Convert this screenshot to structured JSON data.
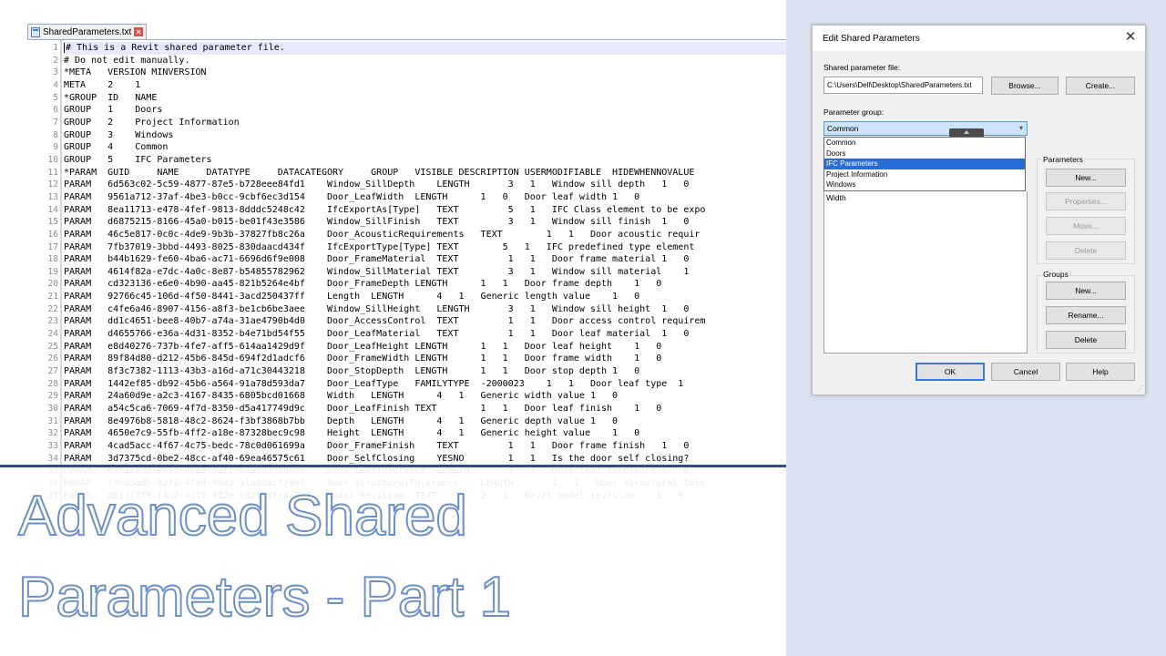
{
  "editor": {
    "tab_label": "SharedParameters.txt",
    "lines": [
      "# This is a Revit shared parameter file.",
      "# Do not edit manually.",
      "*META   VERSION MINVERSION",
      "META    2    1",
      "*GROUP  ID   NAME",
      "GROUP   1    Doors",
      "GROUP   2    Project Information",
      "GROUP   3    Windows",
      "GROUP   4    Common",
      "GROUP   5    IFC Parameters",
      "*PARAM  GUID     NAME     DATATYPE     DATACATEGORY     GROUP   VISIBLE DESCRIPTION USERMODIFIABLE  HIDEWHENNOVALUE",
      "PARAM   6d563c02-5c59-4877-87e5-b728eee84fd1    Window_SillDepth    LENGTH       3   1   Window sill depth   1   0",
      "PARAM   9561a712-37af-4be3-b0cc-9cbf6ec3d154    Door_LeafWidth  LENGTH      1   0   Door leaf width 1   0",
      "PARAM   8ea11713-e478-4fef-9813-8dddc5248c42    IfcExportAs[Type]   TEXT         5   1   IFC Class element to be expo",
      "PARAM   d6875215-8166-45a0-b015-be01f43e3586    Window_SillFinish   TEXT         3   1   Window sill finish  1   0",
      "PARAM   46c5e817-0c0c-4de9-9b3b-37827fb8c26a    Door_AcousticRequirements   TEXT        1   1   Door acoustic requir",
      "PARAM   7fb37019-3bbd-4493-8025-830daacd434f    IfcExportType[Type] TEXT        5   1   IFC predefined type element",
      "PARAM   b44b1629-fe60-4ba6-ac71-6696d6f9e008    Door_FrameMaterial  TEXT         1   1   Door frame material 1   0",
      "PARAM   4614f82a-e7dc-4a0c-8e87-b54855782962    Window_SillMaterial TEXT         3   1   Window sill material    1",
      "PARAM   cd323136-e6e0-4b90-aa45-821b5264e4bf    Door_FrameDepth LENGTH      1   1   Door frame depth    1   0",
      "PARAM   92766c45-106d-4f50-8441-3acd250437ff    Length  LENGTH      4   1   Generic length value    1   0",
      "PARAM   c4fe6a46-8907-4156-a8f3-be1cb6be3aee    Window_SillHeight   LENGTH       3   1   Window sill height  1   0",
      "PARAM   dd1c4651-bee8-40b7-a74a-31ae4790b4d0    Door_AccessControl  TEXT         1   1   Door access control requirem",
      "PARAM   d4655766-e36a-4d31-8352-b4e71bd54f55    Door_LeafMaterial   TEXT         1   1   Door leaf material  1   0",
      "PARAM   e8d40276-737b-4fe7-aff5-614aa1429d9f    Door_LeafHeight LENGTH      1   1   Door leaf height    1   0",
      "PARAM   89f84d80-d212-45b6-845d-694f2d1adcf6    Door_FrameWidth LENGTH      1   1   Door frame width    1   0",
      "PARAM   8f3c7382-1113-43b3-a16d-a71c30443218    Door_StopDepth  LENGTH      1   1   Door stop depth 1   0",
      "PARAM   1442ef85-db92-45b6-a564-91a78d593da7    Door_LeafType   FAMILYTYPE  -2000023    1   1   Door leaf type  1",
      "PARAM   24a60d9e-a2c3-4167-8435-6805bcd01668    Width   LENGTH      4   1   Generic width value 1   0",
      "PARAM   a54c5ca6-7069-4f7d-8350-d5a417749d9c    Door_LeafFinish TEXT        1   1   Door leaf finish    1   0",
      "PARAM   8e4976b8-5818-48c2-8624-f3bf3868b7bb    Depth   LENGTH      4   1   Generic depth value 1   0",
      "PARAM   4650e7c9-55fb-4ff2-a18e-87328bec9c98    Height  LENGTH      4   1   Generic height value    1   0",
      "PARAM   4cad5acc-4f67-4c75-bedc-78c0d061699a    Door_FrameFinish    TEXT         1   1   Door frame finish   1   0",
      "PARAM   3d7375cd-0be2-48cc-af40-69ea46575c61    Door_SelfClosing    YESNO        1   1   Is the door self closing?",
      "PARAM   63b14ad0-904c-46e5-a1f7-679553aeb666    Door_LeafTolerance  LENGTH       1   1   Door leaf tolerance 1   0",
      "PARAM   f30a5adb-82f1-4fa4-80d2-a1a8dacf7906    Door_StructuralTolerance    LENGTH       1   1   Door structural tole",
      "PARAM   d61d17f0-14c2-4c17-932e-c02fb4fe8a70    Model Revision  TEXT        2   1   Revit model revision    1   0"
    ]
  },
  "slide": {
    "title_line1": "Advanced Shared",
    "title_line2": "Parameters - Part 1"
  },
  "dialog": {
    "title": "Edit Shared Parameters",
    "file_label": "Shared parameter file:",
    "file_value": "C:\\Users\\Dell\\Desktop\\SharedParameters.txt",
    "browse": "Browse...",
    "create": "Create...",
    "group_label": "Parameter group:",
    "group_selected": "Common",
    "group_options": [
      "Common",
      "Doors",
      "IFC Parameters",
      "Project Information",
      "Windows"
    ],
    "group_highlighted": "IFC Parameters",
    "parameters_visible": [
      "Width"
    ],
    "parameters_section": "Parameters",
    "param_new": "New...",
    "param_properties": "Properties...",
    "param_move": "Move...",
    "param_delete": "Delete",
    "groups_section": "Groups",
    "group_new": "New...",
    "group_rename": "Rename...",
    "group_delete": "Delete",
    "ok": "OK",
    "cancel": "Cancel",
    "help": "Help"
  },
  "colors": {
    "right_background": "#dbe2f1",
    "title_outline": "#6d8fc8",
    "title_rule": "#2f4f7f",
    "selection": "#2a6cd6"
  }
}
